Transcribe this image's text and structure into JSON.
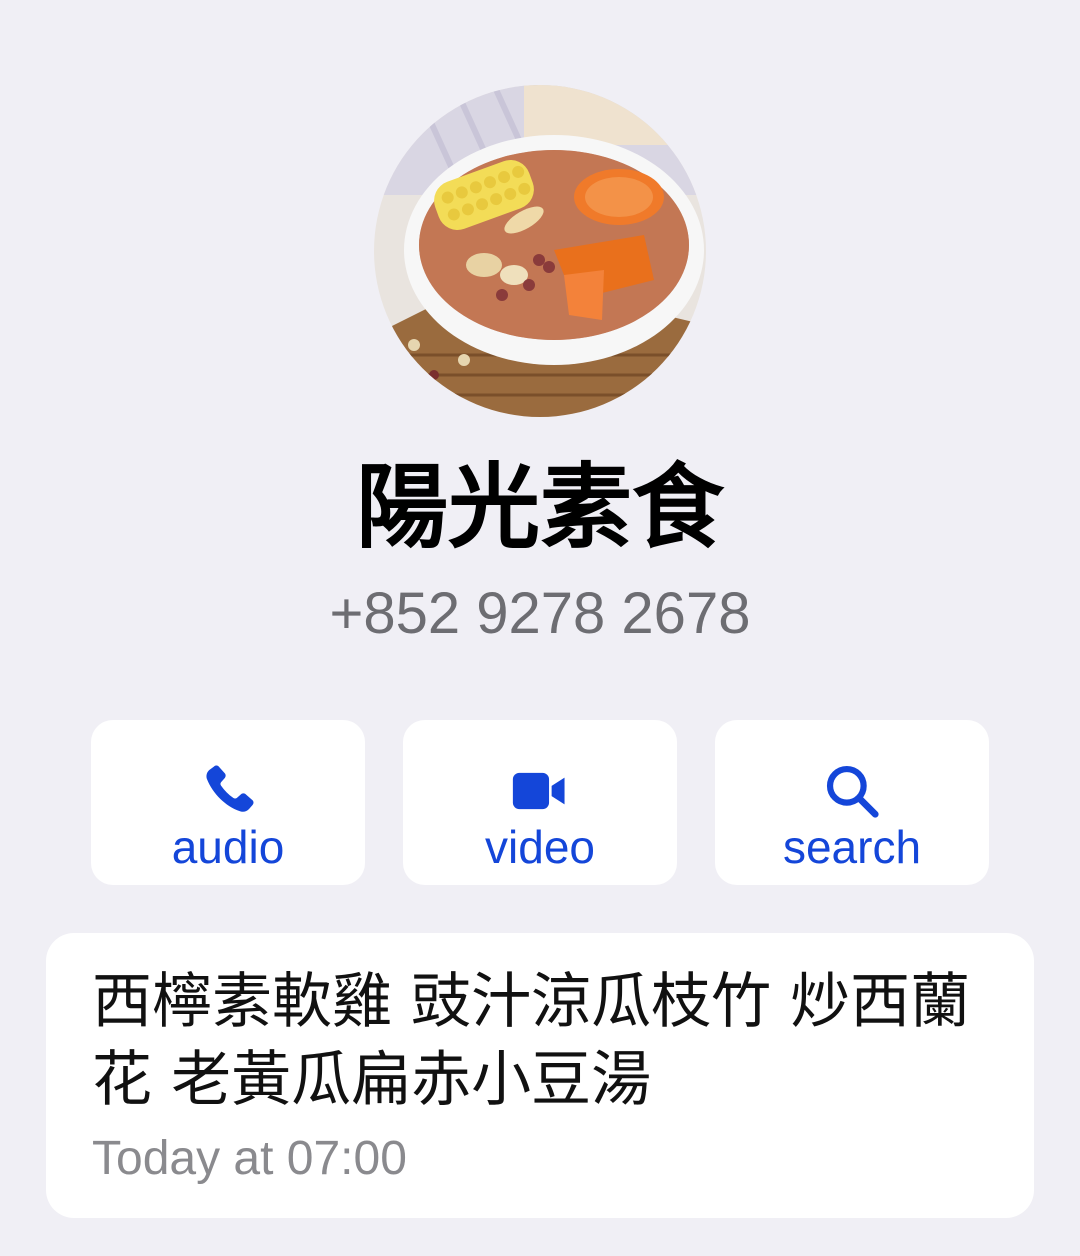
{
  "contact": {
    "name": "陽光素食",
    "phone": "+852 9278 2678",
    "avatar_icon": "soup-bowl-photo"
  },
  "actions": [
    {
      "label": "audio",
      "icon": "phone-icon"
    },
    {
      "label": "video",
      "icon": "video-camera-icon"
    },
    {
      "label": "search",
      "icon": "search-icon"
    }
  ],
  "message": {
    "text": "西檸素軟雞 豉汁涼瓜枝竹 炒西蘭花 老黃瓜扁赤小豆湯",
    "time": "Today at 07:00"
  },
  "colors": {
    "background": "#f0eff5",
    "accent": "#1446d9",
    "secondary_text": "#6d6d72"
  }
}
